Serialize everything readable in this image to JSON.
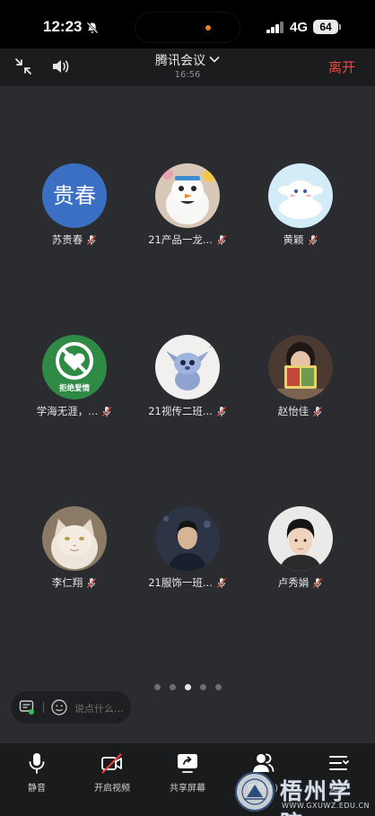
{
  "status_bar": {
    "time": "12:23",
    "network": "4G",
    "battery": "64"
  },
  "header": {
    "title": "腾讯会议",
    "timer": "16:56",
    "leave_label": "离开"
  },
  "participants": [
    {
      "name": "苏贵春",
      "avatar_text": "贵春",
      "avatar_color": "#3a6fc4"
    },
    {
      "name": "21产品一龙...",
      "avatar_icon": "snowman-plush-avatar"
    },
    {
      "name": "黄颖",
      "avatar_icon": "cinnamoroll-avatar"
    },
    {
      "name": "学海无涯，...",
      "avatar_text": "拒绝爱情",
      "avatar_color": "#2f8a45"
    },
    {
      "name": "21视传二班...",
      "avatar_icon": "stitch-sketch-avatar"
    },
    {
      "name": "赵怡佳",
      "avatar_icon": "girl-with-book-avatar"
    },
    {
      "name": "李仁翔",
      "avatar_icon": "white-cat-avatar"
    },
    {
      "name": "21服饰一班...",
      "avatar_icon": "man-portrait-avatar"
    },
    {
      "name": "卢秀娟",
      "avatar_icon": "young-man-portrait-avatar"
    }
  ],
  "pager": {
    "count": 5,
    "active_index": 2
  },
  "chat": {
    "placeholder": "说点什么..."
  },
  "toolbar": [
    {
      "label": "静音",
      "icon": "microphone-icon"
    },
    {
      "label": "开启视频",
      "icon": "video-off-icon"
    },
    {
      "label": "共享屏幕",
      "icon": "share-screen-icon"
    },
    {
      "label": "成员(9)",
      "icon": "members-icon"
    },
    {
      "label": "更多",
      "icon": "more-icon"
    }
  ],
  "watermark": {
    "text": "梧州学院",
    "url": "WWW.GXUWZ.EDU.CN"
  },
  "colors": {
    "accent_red": "#f0463c",
    "stage_bg": "#2a2c2f",
    "bar_bg": "#1a1b1d"
  }
}
